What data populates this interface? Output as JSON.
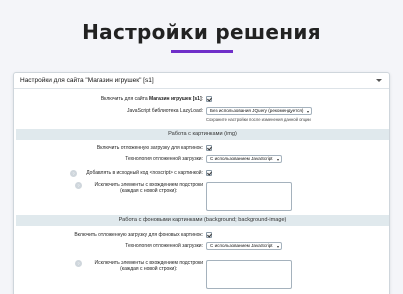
{
  "hero": {
    "title": "Настройки решения"
  },
  "panel": {
    "title": "Настройки для сайта \"Магазин игрушек\" [s1]"
  },
  "settings": {
    "enable_site_prefix": "Включить для сайта ",
    "enable_site_name": "Магазин игрушек [s1]",
    "js_library_label": "JavaScript библиотека LazyLoad:",
    "js_library_value": "Без использования JQuery (рекомендуется)",
    "js_library_note": "Сохраните настройки после изменения данной опции"
  },
  "images_section": {
    "title": "Работа с картинками (img)",
    "lazy_label": "Включить отложенную загрузку для картинок:",
    "tech_label": "Технология отложенной загрузки:",
    "tech_value": "С использованием JavaScript",
    "noscript_label": "Добавлять в исходный код <noscript> с картинкой:",
    "exclude_label_line1": "Исключить элементы с вхождением подстроки",
    "exclude_label_line2": "(каждая с новой строки):",
    "exclude_value": ""
  },
  "bg_section": {
    "title": "Работа с фоновыми картинками (background; background-image)",
    "lazy_label": "Включить отложенную загрузку для фоновых картинок:",
    "tech_label": "Технология отложенной загрузки:",
    "tech_value": "С использованием JavaScript",
    "exclude_label_line1": "Исключить элементы с вхождением подстроки",
    "exclude_label_line2": "(каждая с новой строки):",
    "exclude_value": ""
  },
  "hint_glyph": "?",
  "colors": {
    "accent": "#6f2fc9",
    "section_bg": "#e0e9ed",
    "page_bg": "#f4f5f9"
  }
}
